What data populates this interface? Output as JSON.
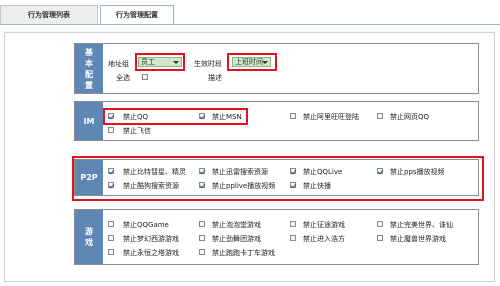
{
  "tabs": [
    {
      "label": "行为管理列表"
    },
    {
      "label": "行为管理配置"
    }
  ],
  "basic": {
    "sidebar_label": "基本配置",
    "address_group_label": "地址组",
    "address_group_value": "员工",
    "time_label": "生效时段",
    "time_value": "上班时间",
    "all_select_label": "全选",
    "desc_label": "描述"
  },
  "im": {
    "sidebar_label": "IM",
    "items": [
      {
        "label": "禁止QQ",
        "checked": true
      },
      {
        "label": "禁止MSN",
        "checked": true
      },
      {
        "label": "禁止阿里旺旺登陆",
        "checked": false
      },
      {
        "label": "禁止网页QQ",
        "checked": false
      },
      {
        "label": "禁止飞信",
        "checked": false
      }
    ]
  },
  "p2p": {
    "sidebar_label": "P2P",
    "items": [
      {
        "label": "禁止比特彗星、精灵",
        "checked": true
      },
      {
        "label": "禁止迅雷搜索资源",
        "checked": true
      },
      {
        "label": "禁止QQLive",
        "checked": true
      },
      {
        "label": "禁止pps播放视频",
        "checked": true
      },
      {
        "label": "禁止酷狗搜索资源",
        "checked": true
      },
      {
        "label": "禁止pplive播放视频",
        "checked": true
      },
      {
        "label": "禁止快播",
        "checked": true
      }
    ]
  },
  "games": {
    "sidebar_label": "游戏",
    "items": [
      {
        "label": "禁止QQGame",
        "checked": false
      },
      {
        "label": "禁止泡泡堂游戏",
        "checked": false
      },
      {
        "label": "禁止征途游戏",
        "checked": false
      },
      {
        "label": "禁止完美世界、诛仙",
        "checked": false
      },
      {
        "label": "禁止梦幻西游游戏",
        "checked": false
      },
      {
        "label": "禁止劲舞团游戏",
        "checked": false
      },
      {
        "label": "禁止进入浩方",
        "checked": false
      },
      {
        "label": "禁止魔兽世界游戏",
        "checked": false
      },
      {
        "label": "禁止永恒之塔游戏",
        "checked": false
      },
      {
        "label": "禁止跑跑卡丁车游戏",
        "checked": false
      }
    ]
  }
}
